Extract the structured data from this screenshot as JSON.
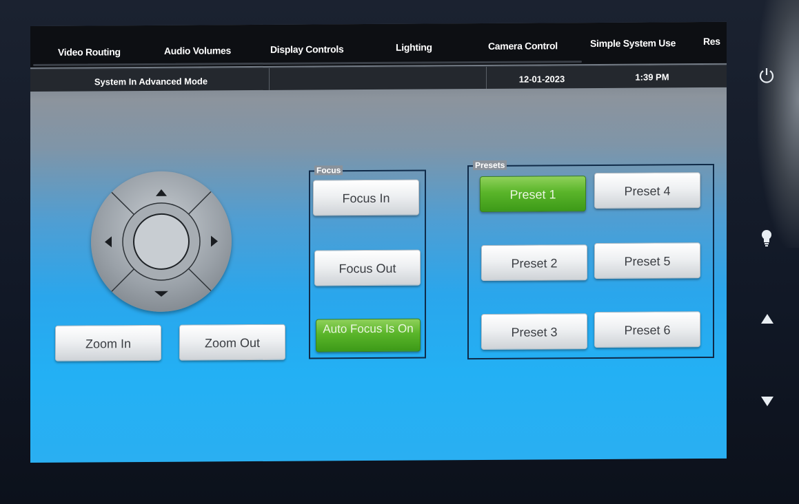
{
  "tabs": [
    {
      "label": "Video Routing"
    },
    {
      "label": "Audio Volumes"
    },
    {
      "label": "Display Controls"
    },
    {
      "label": "Lighting"
    },
    {
      "label": "Camera Control"
    },
    {
      "label": "Simple System Use"
    },
    {
      "label": "Res"
    }
  ],
  "status": {
    "mode": "System In Advanced Mode",
    "middle": "",
    "date": "12-01-2023",
    "time": "1:39 PM"
  },
  "camera": {
    "zoom_in": "Zoom In",
    "zoom_out": "Zoom Out"
  },
  "focus": {
    "title": "Focus",
    "focus_in": "Focus In",
    "focus_out": "Focus Out",
    "auto_focus": "Auto Focus Is On",
    "auto_focus_active": true
  },
  "presets": {
    "title": "Presets",
    "items": [
      {
        "label": "Preset 1",
        "active": true
      },
      {
        "label": "Preset 2",
        "active": false
      },
      {
        "label": "Preset 3",
        "active": false
      },
      {
        "label": "Preset 4",
        "active": false
      },
      {
        "label": "Preset 5",
        "active": false
      },
      {
        "label": "Preset 6",
        "active": false
      }
    ]
  },
  "side_controls": {
    "power_icon": "power-icon",
    "light_icon": "lightbulb-icon",
    "up_icon": "arrow-up-icon",
    "down_icon": "arrow-down-icon"
  },
  "colors": {
    "active_green": "#5ab52a",
    "screen_blue": "#23b0f4",
    "topbar": "#0d0f13"
  }
}
